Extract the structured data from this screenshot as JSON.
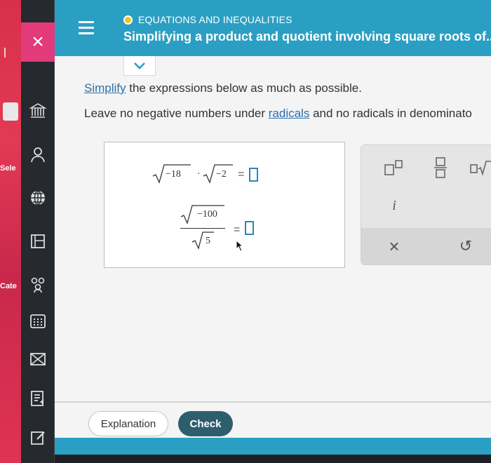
{
  "background": {
    "fragments": [
      "Sele",
      "Cate"
    ]
  },
  "sidebar": {
    "close_glyph": "×",
    "icons": [
      "bank-icon",
      "user-icon",
      "globe-icon",
      "worksheet-icon",
      "people-icon",
      "calculator-icon",
      "envelope-icon",
      "reader-icon",
      "edit-icon"
    ]
  },
  "header": {
    "topic": "EQUATIONS AND INEQUALITIES",
    "title": "Simplifying a product and quotient involving square roots of..."
  },
  "instructions": {
    "line1_link": "Simplify",
    "line1_rest": " the expressions below as much as possible.",
    "line2_start": "Leave no negative numbers under ",
    "line2_link": "radicals",
    "line2_rest": " and no radicals in denominato"
  },
  "problems": {
    "p1": {
      "radicand_a": "−18",
      "dot": "·",
      "radicand_b": "−2",
      "equals": "="
    },
    "p2": {
      "numerator": "−100",
      "denominator": "5",
      "equals": "="
    }
  },
  "palette": {
    "imaginary_unit": "i",
    "clear_glyph": "×",
    "undo_glyph": "↺"
  },
  "buttons": {
    "explanation": "Explanation",
    "check": "Check"
  },
  "colors": {
    "header": "#2b9fc3",
    "accent_pink": "#e23a7a",
    "check_button": "#2e5e6e",
    "answer_box": "#2b87b8"
  }
}
